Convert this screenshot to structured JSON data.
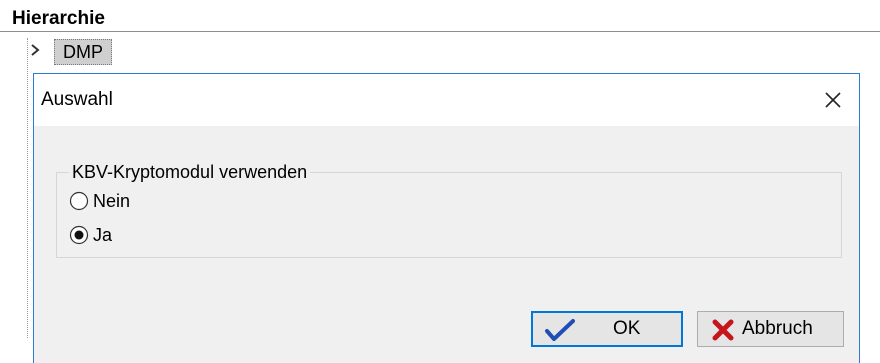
{
  "hierarchy": {
    "title": "Hierarchie",
    "node_label": "DMP"
  },
  "dialog": {
    "title": "Auswahl",
    "group_label": "KBV-Kryptomodul verwenden",
    "options": [
      {
        "label": "Nein",
        "selected": false
      },
      {
        "label": "Ja",
        "selected": true
      }
    ],
    "ok_label": "OK",
    "cancel_label": "Abbruch"
  },
  "colors": {
    "accent": "#0078d7",
    "ok_check": "#1f4fb5",
    "cancel_x": "#c4161c"
  }
}
